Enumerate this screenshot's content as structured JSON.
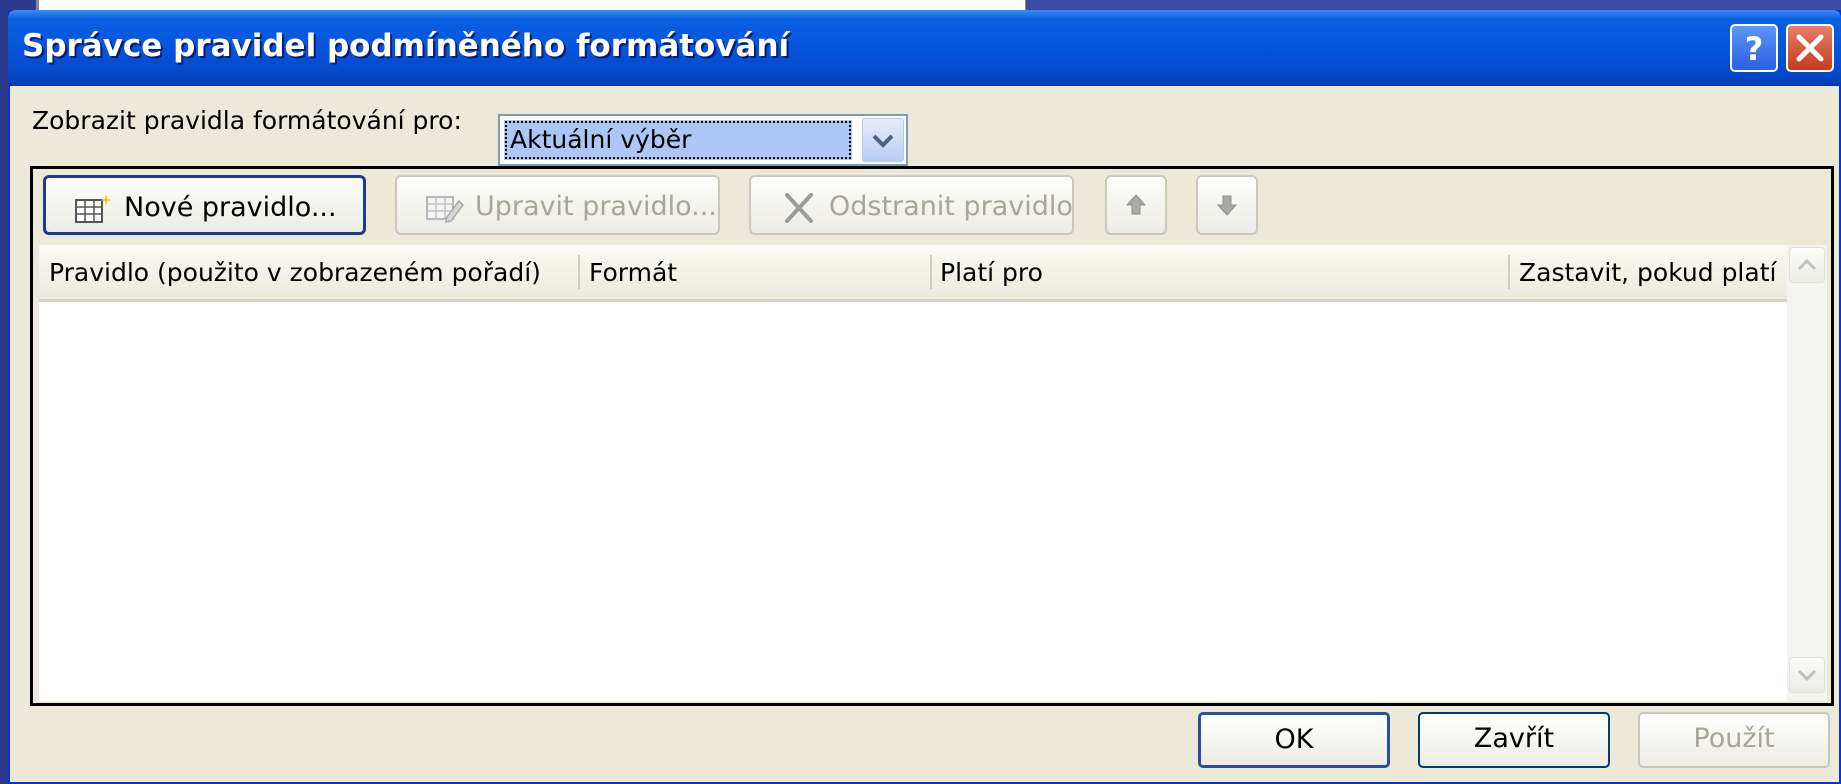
{
  "dialog": {
    "title": "Správce pravidel podmíněného formátování",
    "help_icon": "help-icon",
    "close_icon": "close-icon"
  },
  "show_rules": {
    "label": "Zobrazit pravidla formátování pro:",
    "selected": "Aktuální výběr"
  },
  "toolbar": {
    "new_rule": "Nové pravidlo...",
    "edit_rule": "Upravit pravidlo...",
    "delete_rule": "Odstranit pravidlo"
  },
  "columns": [
    "Pravidlo (použito v zobrazeném pořadí)",
    "Formát",
    "Platí pro",
    "Zastavit, pokud platí"
  ],
  "footer": {
    "ok": "OK",
    "close": "Zavřít",
    "apply": "Použít"
  },
  "colors": {
    "title_bar": "#0654dc",
    "dialog_bg": "#ece9d8",
    "selection": "#adc6f4"
  }
}
